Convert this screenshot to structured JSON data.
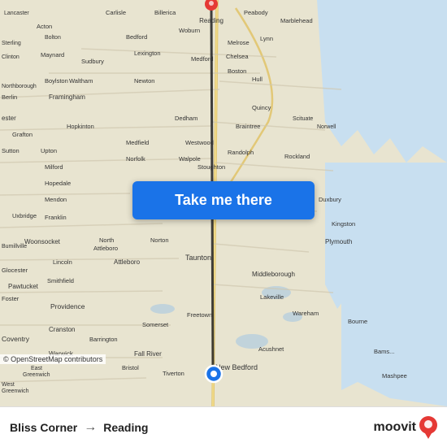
{
  "map": {
    "background_color": "#e8e0d0",
    "water_color": "#b8d4e8",
    "road_color": "#ffffff",
    "land_color": "#f0ece0"
  },
  "button": {
    "label": "Take me there",
    "background": "#1a73e8",
    "text_color": "#ffffff"
  },
  "bottom_bar": {
    "origin": "Bliss Corner",
    "arrow": "→",
    "destination": "Reading",
    "attribution": "© OpenStreetMap contributors",
    "logo_text": "moovit"
  },
  "route": {
    "start_label": "Bliss Corner",
    "end_label": "Reading"
  }
}
